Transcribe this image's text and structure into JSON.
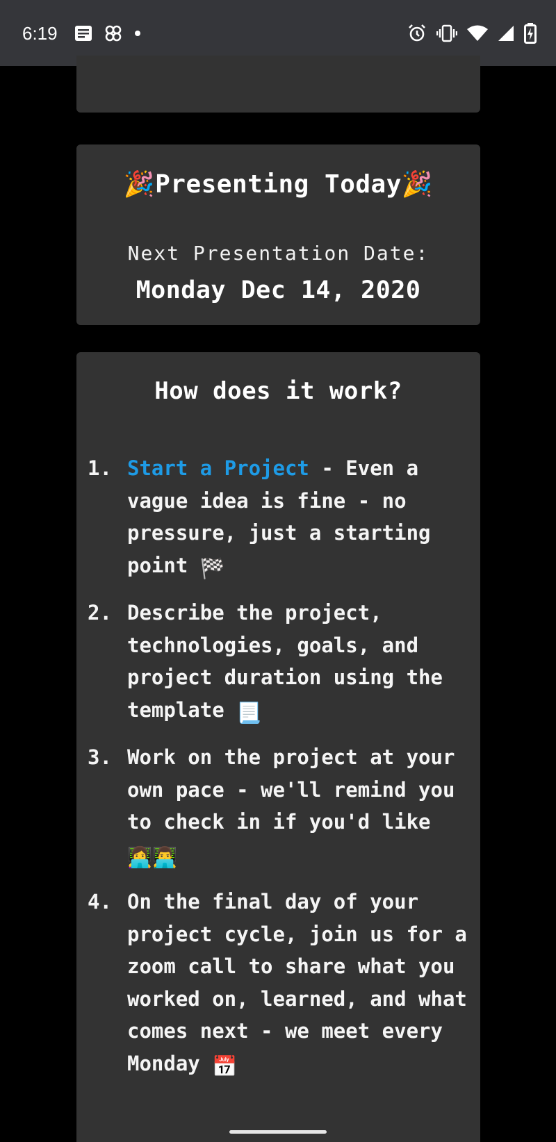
{
  "status_bar": {
    "time": "6:19",
    "left_icons": [
      "notes-icon",
      "pinwheel-icon",
      "notification-dot-icon"
    ],
    "right_icons": [
      "alarm-icon",
      "vibrate-icon",
      "wifi-icon",
      "signal-icon",
      "battery-charging-icon"
    ]
  },
  "presenting": {
    "title": "🎉Presenting Today🎉",
    "date_label": "Next Presentation Date:",
    "date_value": "Monday Dec 14, 2020"
  },
  "how_it_works": {
    "title": "How does it work?",
    "steps": [
      {
        "number": "1.",
        "link_text": "Start a Project",
        "text": " - Even a vague idea is fine - no pressure, just a starting point ",
        "emoji": "🏁"
      },
      {
        "number": "2.",
        "text": "Describe the project, technologies, goals, and project duration using the template ",
        "emoji": "📃"
      },
      {
        "number": "3.",
        "text": "Work on the project at your own pace - we'll remind you to check in if you'd like ",
        "emoji": "👩‍💻👨‍💻"
      },
      {
        "number": "4.",
        "text": "On the final day of your project cycle, join us for a zoom call to share what you worked on, learned, and what comes next - we meet every Monday ",
        "emoji": "📅"
      }
    ]
  },
  "colors": {
    "status_bar_bg": "#35363a",
    "page_bg": "#000000",
    "card_bg": "#333333",
    "link": "#1e9be6",
    "text": "#ffffff"
  }
}
